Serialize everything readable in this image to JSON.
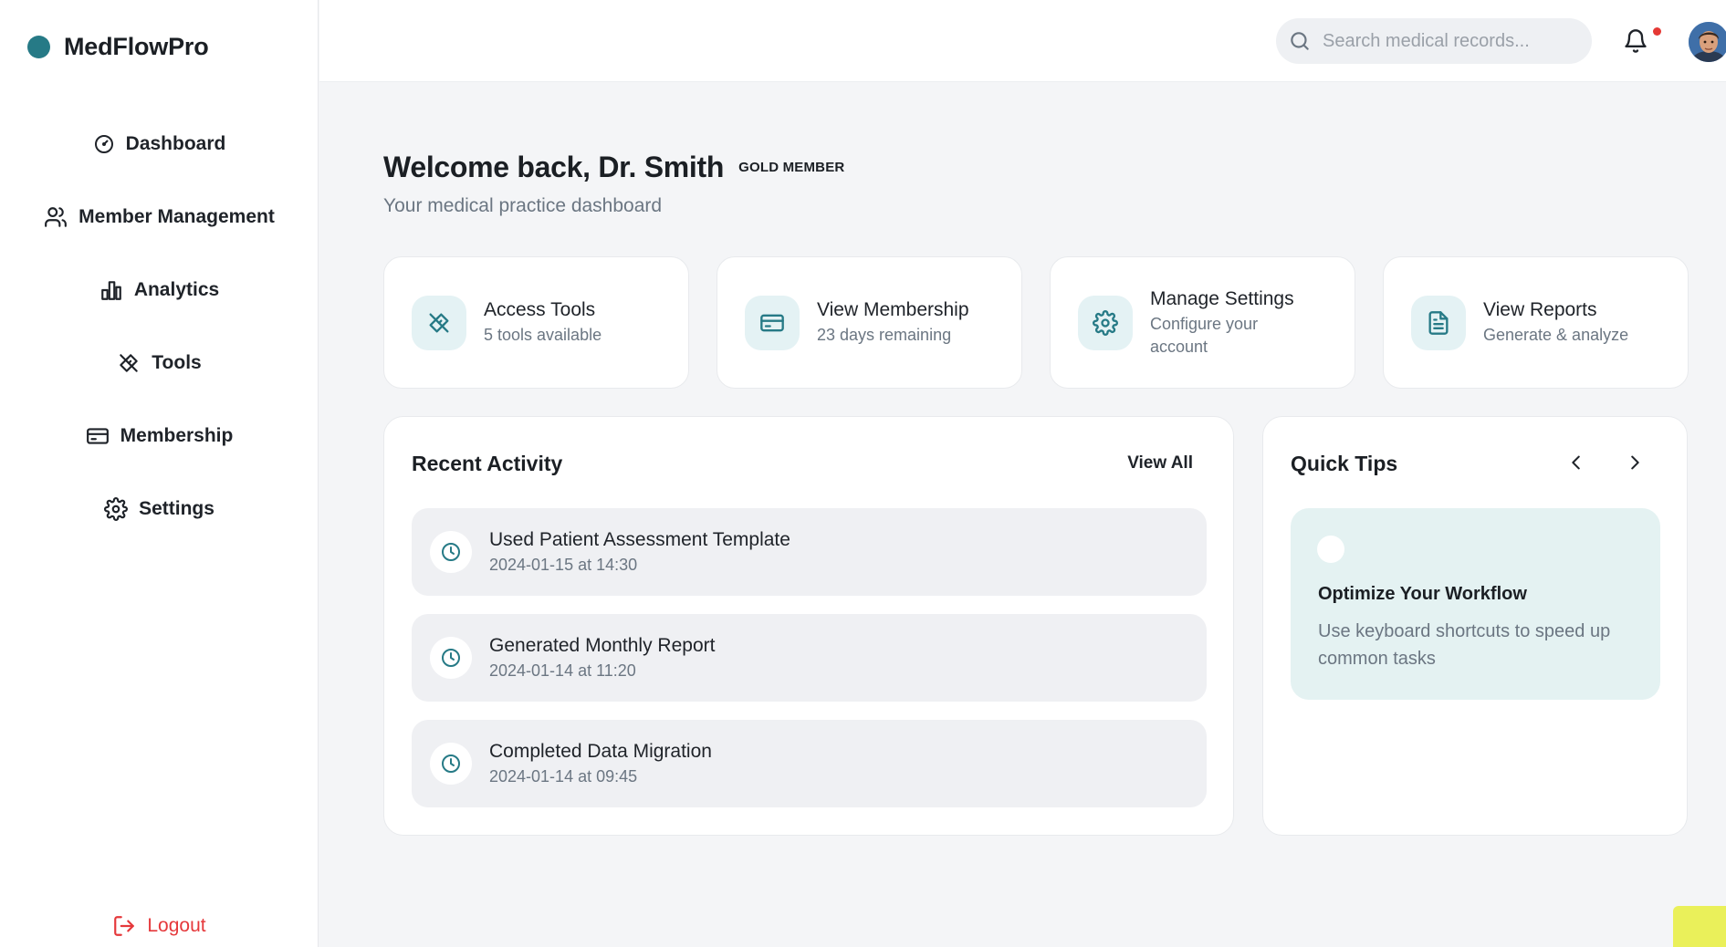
{
  "app": {
    "name": "MedFlowPro",
    "brand_color": "#267a86"
  },
  "sidebar": {
    "items": [
      {
        "label": "Dashboard",
        "icon": "gauge-icon"
      },
      {
        "label": "Member Management",
        "icon": "users-icon"
      },
      {
        "label": "Analytics",
        "icon": "bar-chart-icon"
      },
      {
        "label": "Tools",
        "icon": "tools-icon"
      },
      {
        "label": "Membership",
        "icon": "credit-card-icon"
      },
      {
        "label": "Settings",
        "icon": "gear-icon"
      }
    ],
    "logout_label": "Logout",
    "logout_color": "#e5383b"
  },
  "header": {
    "search_placeholder": "Search medical records...",
    "notification_dot_color": "#e53935"
  },
  "welcome": {
    "title": "Welcome back, Dr. Smith",
    "badge": "GOLD MEMBER",
    "subtitle": "Your medical practice dashboard"
  },
  "cards": [
    {
      "title": "Access Tools",
      "subtitle": "5 tools available",
      "icon": "tools-icon"
    },
    {
      "title": "View Membership",
      "subtitle": "23 days remaining",
      "icon": "credit-card-icon"
    },
    {
      "title": "Manage Settings",
      "subtitle": "Configure your account",
      "icon": "gear-icon"
    },
    {
      "title": "View Reports",
      "subtitle": "Generate & analyze",
      "icon": "document-icon"
    }
  ],
  "recent_activity": {
    "title": "Recent Activity",
    "view_all": "View All",
    "items": [
      {
        "title": "Used Patient Assessment Template",
        "time": "2024-01-15 at 14:30"
      },
      {
        "title": "Generated Monthly Report",
        "time": "2024-01-14 at 11:20"
      },
      {
        "title": "Completed Data Migration",
        "time": "2024-01-14 at 09:45"
      }
    ]
  },
  "quick_tips": {
    "title": "Quick Tips",
    "tip_title": "Optimize Your Workflow",
    "tip_body": "Use keyboard shortcuts to speed up common tasks"
  }
}
